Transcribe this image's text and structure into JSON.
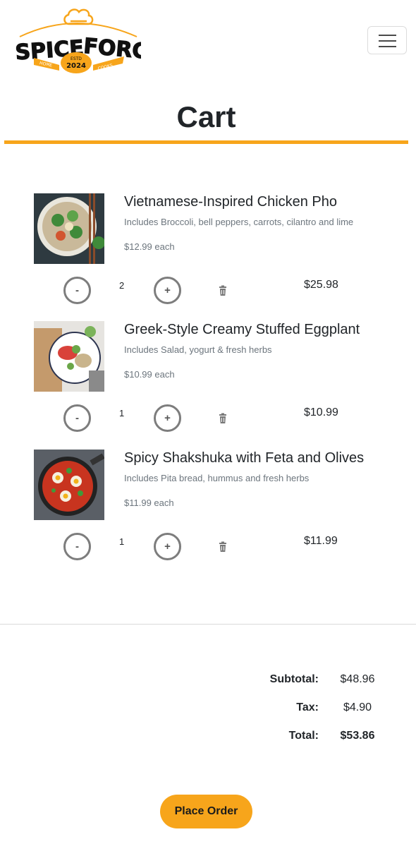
{
  "brand": {
    "name_part1": "SPICE",
    "name_part2": "FORGE",
    "ribbon_left": "HOME",
    "ribbon_right": "COOKS",
    "estd": "ESTD",
    "year": "2024",
    "accent_color": "#f7a51b"
  },
  "header": {
    "menu_icon": "hamburger-icon"
  },
  "page": {
    "title": "Cart"
  },
  "cart": {
    "items": [
      {
        "name": "Vietnamese-Inspired Chicken Pho",
        "description": "Includes Broccoli, bell peppers, carrots, cilantro and lime",
        "unit_price": "$12.99 each",
        "quantity": "2",
        "line_total": "$25.98",
        "minus_label": "-",
        "plus_label": "+"
      },
      {
        "name": "Greek-Style Creamy Stuffed Eggplant",
        "description": "Includes Salad, yogurt & fresh herbs",
        "unit_price": "$10.99 each",
        "quantity": "1",
        "line_total": "$10.99",
        "minus_label": "-",
        "plus_label": "+"
      },
      {
        "name": "Spicy Shakshuka with Feta and Olives",
        "description": "Includes Pita bread, hummus and fresh herbs",
        "unit_price": "$11.99 each",
        "quantity": "1",
        "line_total": "$11.99",
        "minus_label": "-",
        "plus_label": "+"
      }
    ]
  },
  "totals": {
    "subtotal_label": "Subtotal:",
    "subtotal_value": "$48.96",
    "tax_label": "Tax:",
    "tax_value": "$4.90",
    "total_label": "Total:",
    "total_value": "$53.86"
  },
  "actions": {
    "place_order_label": "Place Order"
  }
}
